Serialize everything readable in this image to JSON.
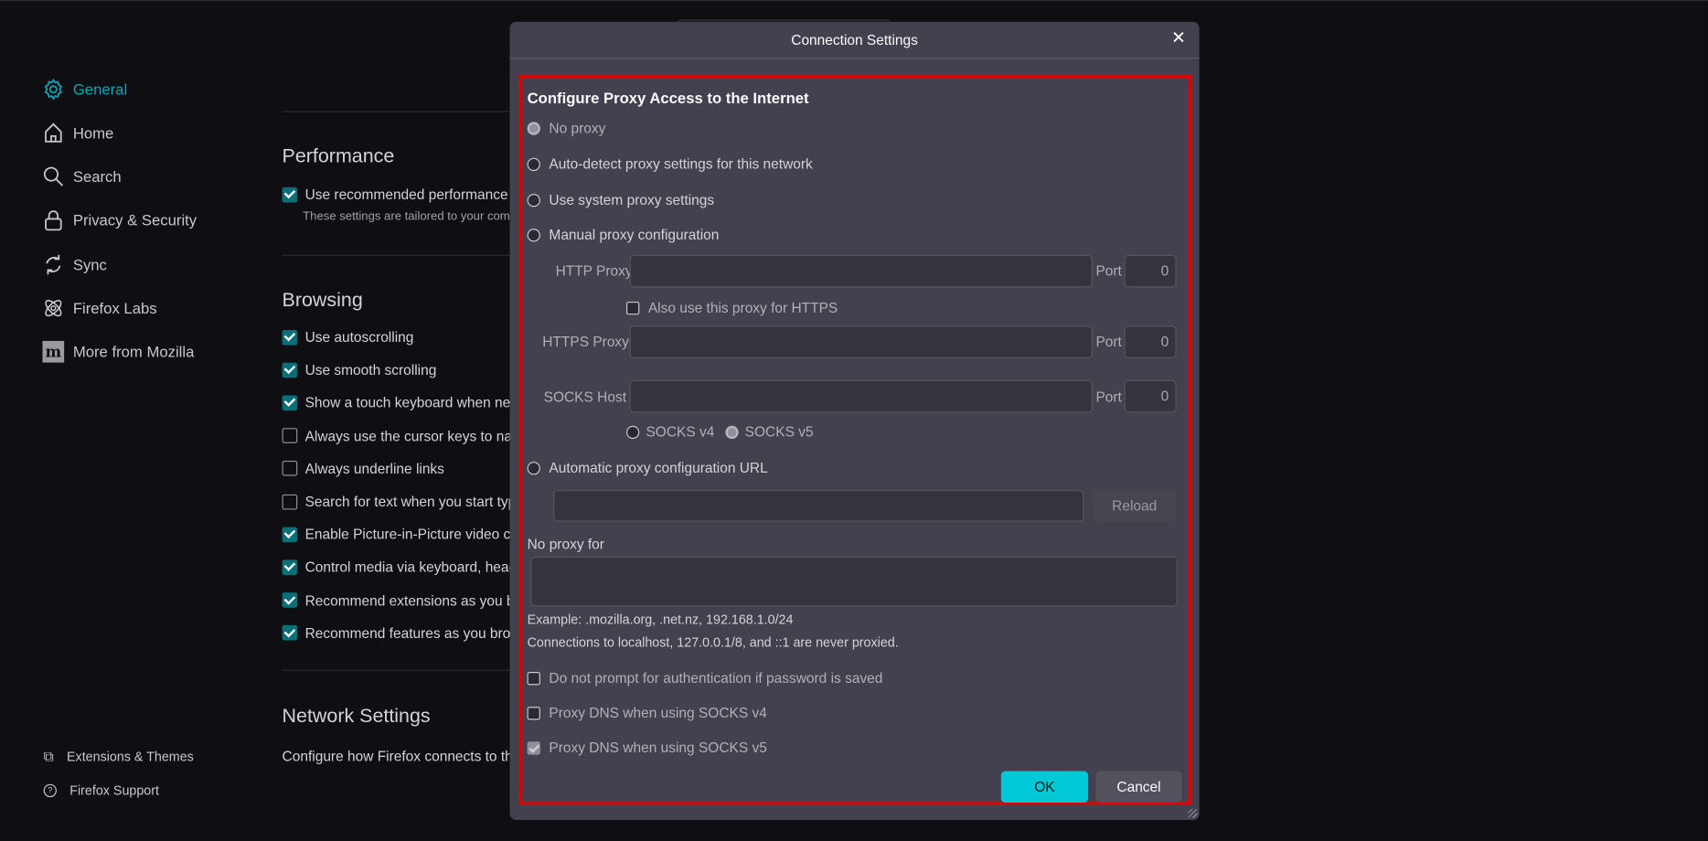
{
  "sidebar": {
    "items": [
      {
        "label": "General",
        "icon": "gear-icon",
        "active": true
      },
      {
        "label": "Home",
        "icon": "home-icon"
      },
      {
        "label": "Search",
        "icon": "search-icon"
      },
      {
        "label": "Privacy & Security",
        "icon": "lock-icon"
      },
      {
        "label": "Sync",
        "icon": "sync-icon"
      },
      {
        "label": "Firefox Labs",
        "icon": "atom-icon"
      },
      {
        "label": "More from Mozilla",
        "icon": "mozilla-icon"
      }
    ],
    "footer": [
      {
        "label": "Extensions & Themes",
        "icon": "puzzle-icon"
      },
      {
        "label": "Firefox Support",
        "icon": "help-icon"
      }
    ]
  },
  "main": {
    "performance": {
      "title": "Performance",
      "option": "Use recommended performance settings",
      "note": "These settings are tailored to your computer's hardware and operating system."
    },
    "browsing": {
      "title": "Browsing",
      "options": [
        {
          "label": "Use autoscrolling",
          "checked": true
        },
        {
          "label": "Use smooth scrolling",
          "checked": true
        },
        {
          "label": "Show a touch keyboard when necessary",
          "checked": true
        },
        {
          "label": "Always use the cursor keys to navigate within pages",
          "checked": false
        },
        {
          "label": "Always underline links",
          "checked": false
        },
        {
          "label": "Search for text when you start typing",
          "checked": false
        },
        {
          "label": "Enable Picture-in-Picture video controls",
          "checked": true
        },
        {
          "label": "Control media via keyboard, headset, or virtual interface",
          "checked": true
        },
        {
          "label": "Recommend extensions as you browse",
          "checked": true
        },
        {
          "label": "Recommend features as you browse",
          "checked": true
        }
      ]
    },
    "network": {
      "title": "Network Settings",
      "description": "Configure how Firefox connects to the internet."
    }
  },
  "dialog": {
    "title": "Connection Settings",
    "close_icon": "close-icon",
    "heading": "Configure Proxy Access to the Internet",
    "proxy_options": [
      {
        "label": "No proxy",
        "selected": true
      },
      {
        "label": "Auto-detect proxy settings for this network",
        "selected": false
      },
      {
        "label": "Use system proxy settings",
        "selected": false
      },
      {
        "label": "Manual proxy configuration",
        "selected": false
      }
    ],
    "http_proxy": {
      "label": "HTTP Proxy",
      "value": "",
      "port_label": "Port",
      "port": "0"
    },
    "also_https": {
      "label": "Also use this proxy for HTTPS",
      "checked": false
    },
    "https_proxy": {
      "label": "HTTPS Proxy",
      "value": "",
      "port_label": "Port",
      "port": "0"
    },
    "socks_host": {
      "label": "SOCKS Host",
      "value": "",
      "port_label": "Port",
      "port": "0"
    },
    "socks_versions": [
      {
        "label": "SOCKS v4",
        "selected": false
      },
      {
        "label": "SOCKS v5",
        "selected": true
      }
    ],
    "auto_config": {
      "label": "Automatic proxy configuration URL",
      "value": "",
      "reload_label": "Reload"
    },
    "no_proxy_for": {
      "label": "No proxy for",
      "value": ""
    },
    "example": "Example: .mozilla.org, .net.nz, 192.168.1.0/24",
    "localhost_note": "Connections to localhost, 127.0.0.1/8, and ::1 are never proxied.",
    "checkboxes": [
      {
        "label": "Do not prompt for authentication if password is saved",
        "checked": false
      },
      {
        "label": "Proxy DNS when using SOCKS v4",
        "checked": false
      },
      {
        "label": "Proxy DNS when using SOCKS v5",
        "checked": true
      }
    ],
    "ok_label": "OK",
    "cancel_label": "Cancel"
  },
  "colors": {
    "accent": "#00c8d7",
    "highlight_border": "#e50000",
    "dialog_bg": "#42414d",
    "page_bg": "#0f0f13"
  }
}
